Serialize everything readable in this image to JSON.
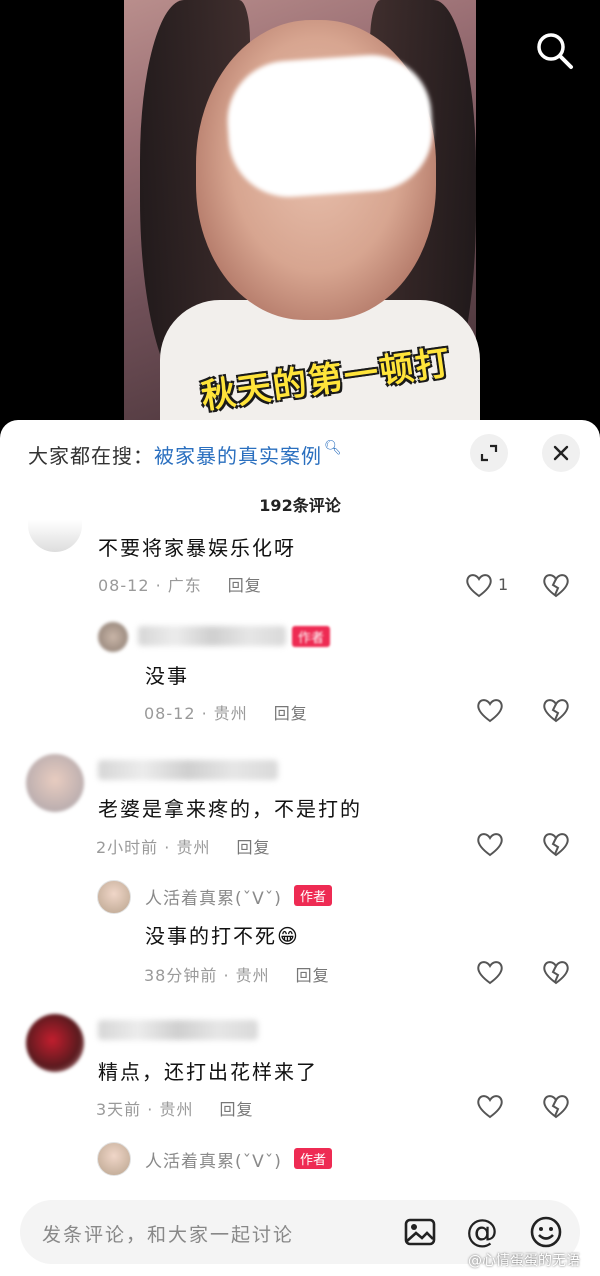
{
  "video": {
    "caption": "秋天的第一顿打"
  },
  "sheet": {
    "search_prefix": "大家都在搜：",
    "search_keyword": "被家暴的真实案例",
    "comment_count": "192条评论"
  },
  "comments": [
    {
      "text": "不要将家暴娱乐化呀",
      "meta": "08-12 · 广东",
      "reply": "回复",
      "likes": "1"
    },
    {
      "text": "没事",
      "meta": "08-12 · 贵州",
      "reply": "回复",
      "badge": "作者"
    },
    {
      "text": "老婆是拿来疼的，不是打的",
      "meta": "2小时前 · 贵州",
      "reply": "回复"
    },
    {
      "author": "人活着真累(ˇVˇ)",
      "badge": "作者",
      "text": "没事的打不死😁",
      "meta": "38分钟前 · 贵州",
      "reply": "回复"
    },
    {
      "text": "精点，还打出花样来了",
      "meta": "3天前 · 贵州",
      "reply": "回复"
    },
    {
      "author": "人活着真累(ˇVˇ)",
      "badge": "作者"
    }
  ],
  "bottom_bar": {
    "input_placeholder": "发条评论，和大家一起讨论"
  },
  "watermark": "@心情蛋蛋的无语",
  "colors": {
    "accent_link": "#2a6fbf",
    "author_badge": "#ee2b53",
    "caption": "#ffe43a"
  }
}
